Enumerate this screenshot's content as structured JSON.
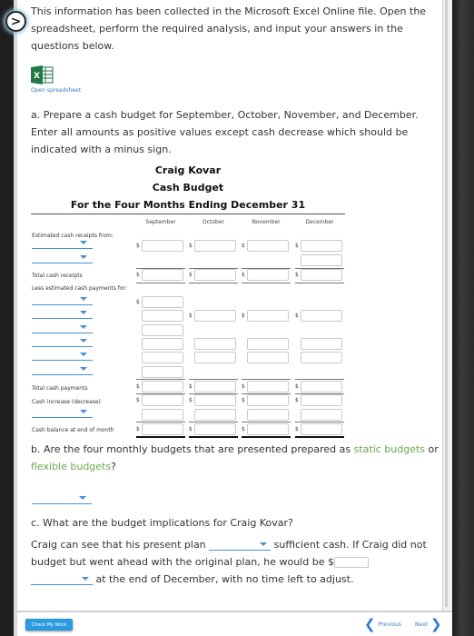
{
  "intro_text": "This information has been collected in the Microsoft Excel Online file. Open the spreadsheet, perform the required analysis, and input your answers in the questions below.",
  "open_spreadsheet_label": "Open spreadsheet",
  "part_a": {
    "prompt": "a. Prepare a cash budget for September, October, November, and December. Enter all amounts as positive values except cash decrease which should be indicated with a minus sign.",
    "company": "Craig Kovar",
    "statement": "Cash Budget",
    "period": "For the Four Months Ending December 31",
    "columns": [
      "September",
      "October",
      "November",
      "December"
    ],
    "labels": {
      "receipts_header": "Estimated cash receipts from:",
      "total_receipts": "Total cash receipts",
      "payments_header": "Less estimated cash payments for:",
      "total_payments": "Total cash payments",
      "cash_change": "Cash increase (decrease)",
      "ending_balance": "Cash balance at end of month"
    },
    "currency_symbol": "$"
  },
  "part_b": {
    "prompt_start": "b. Are the four monthly budgets that are presented prepared as ",
    "term1": "static budgets",
    "middle": " or ",
    "term2": "flexible budgets",
    "end": "?"
  },
  "part_c": {
    "prompt": "c. What are the budget implications for Craig Kovar?",
    "s1": "Craig can see that his present plan ",
    "s2": " sufficient cash. If Craig did not budget but went ahead with the original plan, he would be $",
    "s3": " at the end of December, with no time left to adjust."
  },
  "footer": {
    "check_label": "Check My Work",
    "previous_label": "Previous",
    "next_label": "Next"
  },
  "colors": {
    "accent_blue": "#2a9be0",
    "link_blue": "#3b7cc4",
    "glossary_green": "#6aa84f"
  }
}
